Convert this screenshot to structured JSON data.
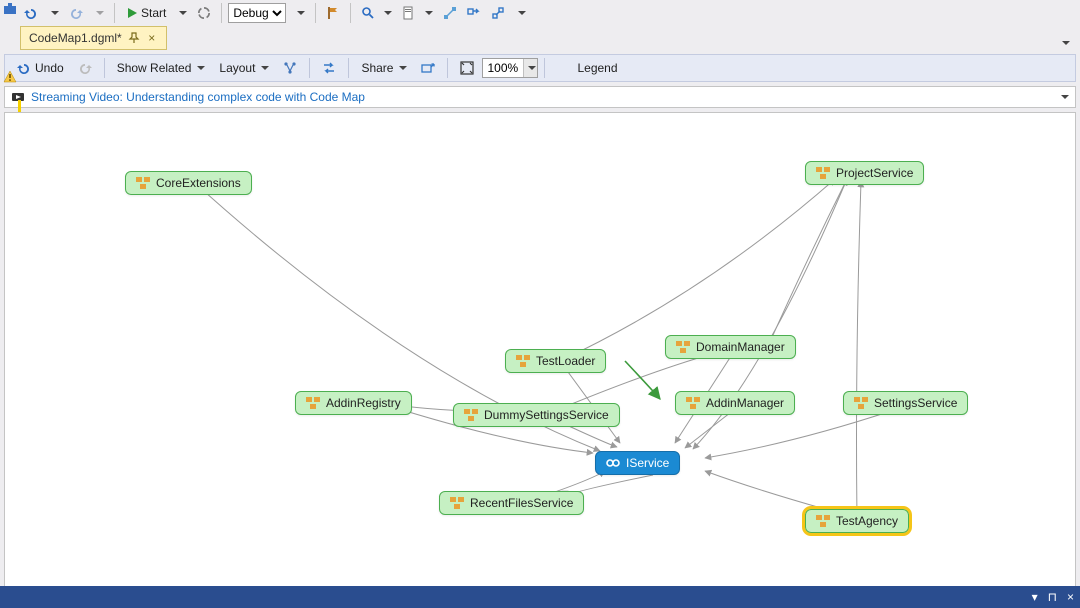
{
  "mainToolbar": {
    "start_label": "Start",
    "debug_option": "Debug"
  },
  "tab": {
    "filename": "CodeMap1.dgml*"
  },
  "cmToolbar": {
    "undo": "Undo",
    "show_related": "Show Related",
    "layout": "Layout",
    "share": "Share",
    "zoom": "100%",
    "legend": "Legend"
  },
  "banner": {
    "text": "Streaming Video: Understanding complex code with Code Map"
  },
  "nodes": {
    "core_extensions": "CoreExtensions",
    "project_service": "ProjectService",
    "test_loader": "TestLoader",
    "domain_manager": "DomainManager",
    "addin_registry": "AddinRegistry",
    "dummy_settings": "DummySettingsService",
    "addin_manager": "AddinManager",
    "settings_service": "SettingsService",
    "iservice": "IService",
    "recent_files": "RecentFilesService",
    "test_agency": "TestAgency"
  },
  "status": {
    "dropdown": "▾",
    "pin": "⊓",
    "close": "×"
  }
}
